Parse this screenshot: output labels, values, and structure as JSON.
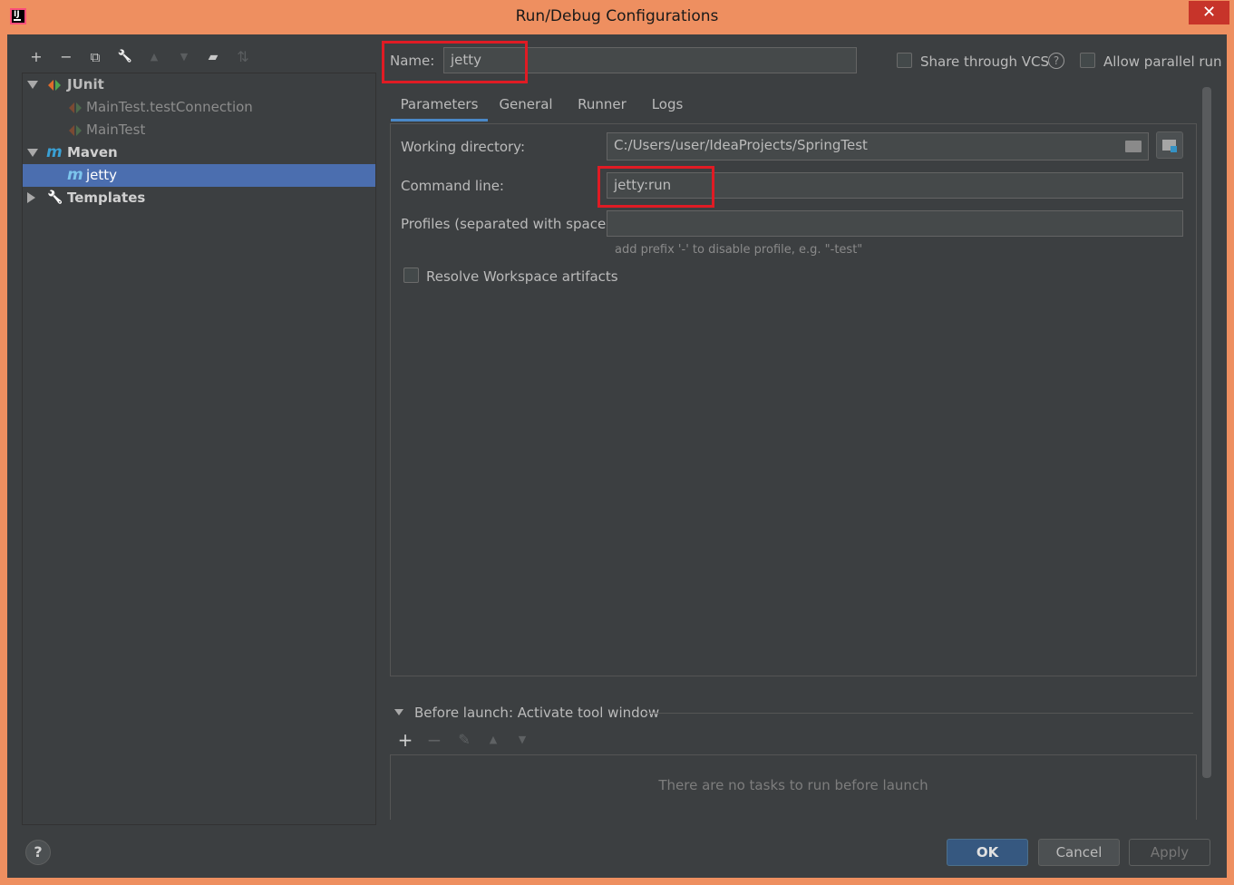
{
  "window": {
    "title": "Run/Debug Configurations",
    "close_glyph": "✕",
    "app_icon": "intellij-idea-icon"
  },
  "left_toolbar": [
    {
      "icon": "add-icon",
      "glyph": "+",
      "enabled": true
    },
    {
      "icon": "remove-icon",
      "glyph": "−",
      "enabled": true
    },
    {
      "icon": "copy-icon",
      "glyph": "⧉",
      "enabled": true
    },
    {
      "icon": "wrench-icon",
      "glyph": "🔧",
      "enabled": true
    },
    {
      "icon": "move-up-icon",
      "glyph": "▲",
      "enabled": false
    },
    {
      "icon": "move-down-icon",
      "glyph": "▼",
      "enabled": false
    },
    {
      "icon": "new-folder-icon",
      "glyph": "▰",
      "enabled": true
    },
    {
      "icon": "sort-icon",
      "glyph": "⇅",
      "enabled": false
    }
  ],
  "tree": {
    "junit": {
      "label": "JUnit",
      "expanded": true
    },
    "junit_children": [
      "MainTest.testConnection",
      "MainTest"
    ],
    "maven": {
      "label": "Maven",
      "expanded": true
    },
    "maven_children": [
      "jetty"
    ],
    "templates": {
      "label": "Templates",
      "expanded": false
    }
  },
  "name_field": {
    "label": "Name:",
    "value": "jetty"
  },
  "share_vcs": {
    "label": "Share through VCS",
    "checked": false
  },
  "allow_parallel": {
    "label": "Allow parallel run",
    "checked": false
  },
  "tabs": [
    "Parameters",
    "General",
    "Runner",
    "Logs"
  ],
  "active_tab": "Parameters",
  "parameters": {
    "working_directory_label": "Working directory:",
    "working_directory_value": "C:/Users/user/IdeaProjects/SpringTest",
    "command_line_label": "Command line:",
    "command_line_value": "jetty:run",
    "profiles_label": "Profiles (separated with space):",
    "profiles_value": "",
    "profiles_hint": "add prefix '-' to disable profile, e.g. \"-test\"",
    "resolve_workspace_label": "Resolve Workspace artifacts",
    "resolve_workspace_checked": false
  },
  "before_launch": {
    "title": "Before launch: Activate tool window",
    "empty_text": "There are no tasks to run before launch"
  },
  "buttons": {
    "ok": "OK",
    "cancel": "Cancel",
    "apply": "Apply",
    "help": "?"
  },
  "colors": {
    "window_frame": "#ee8f60",
    "dialog_bg": "#3c3f41",
    "selection": "#4b6eaf",
    "highlight_box": "#e01b24",
    "tab_underline": "#4a88c7"
  }
}
